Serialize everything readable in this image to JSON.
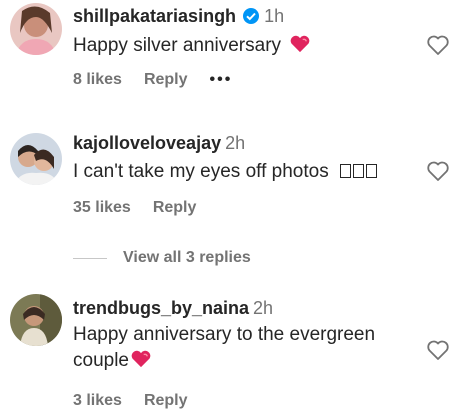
{
  "comments": [
    {
      "username": "shillpakatariasingh",
      "verified": true,
      "time": "1h",
      "text": "Happy silver anniversary",
      "likes": "8 likes",
      "reply": "Reply",
      "more": "•••"
    },
    {
      "username": "kajolloveloveajay",
      "time": "2h",
      "text": "I can't take my eyes off photos",
      "likes": "35 likes",
      "reply": "Reply",
      "view_replies": "View all 3 replies"
    },
    {
      "username": "trendbugs_by_naina",
      "time": "2h",
      "text_line1": "Happy anniversary to the evergreen",
      "text_line2": "couple",
      "likes": "3 likes",
      "reply": "Reply"
    }
  ],
  "colors": {
    "heart": "#e0245e",
    "verified": "#0095f6",
    "secondary": "#737373"
  }
}
